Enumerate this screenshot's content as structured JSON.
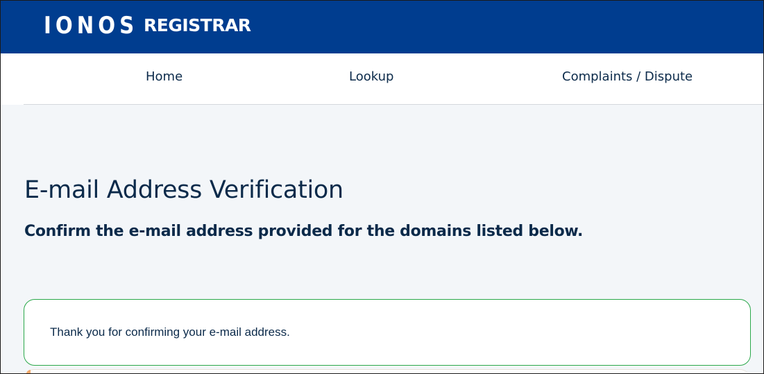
{
  "header": {
    "logo_text": "IONOS",
    "brand_suffix": "REGISTRAR",
    "background_color": "#003d8f"
  },
  "nav": {
    "items": [
      {
        "label": "Home"
      },
      {
        "label": "Lookup"
      },
      {
        "label": "Complaints / Dispute"
      }
    ]
  },
  "main": {
    "title": "E-mail Address Verification",
    "subtitle": "Confirm the e-mail address provided for the domains listed below.",
    "success_message": "Thank you for confirming your e-mail address.",
    "success_border_color": "#2aa84a",
    "background_color": "#f3f6f9"
  }
}
